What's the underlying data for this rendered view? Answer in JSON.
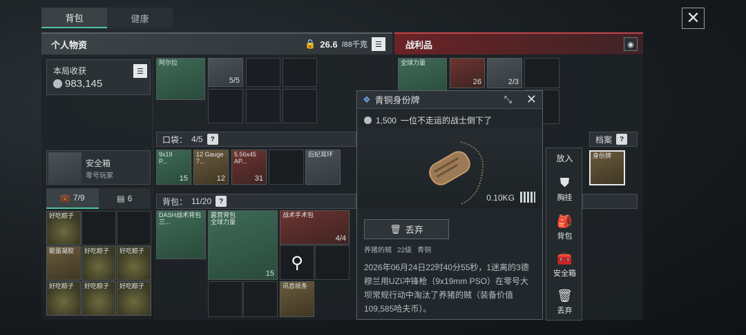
{
  "tabs": [
    "背包",
    "健康"
  ],
  "close_icon": "close-icon",
  "left_header": {
    "title": "个人物资",
    "weight": "26.6",
    "weight_max": "/88千克"
  },
  "right_header": {
    "title": "战利品"
  },
  "earnings": {
    "label": "本局收获",
    "value": "983,145"
  },
  "safebox": {
    "title": "安全箱",
    "owner": "零号玩家"
  },
  "counts": {
    "a": "7/9",
    "b": "6"
  },
  "left_items": [
    {
      "name": "好吃粽子"
    },
    {
      "name": "能量凝胶"
    },
    {
      "name": "好吃粽子"
    },
    {
      "name": "好吃粽子"
    },
    {
      "name": "好吃粽子"
    },
    {
      "name": "好吃粽子"
    },
    {
      "name": "好吃粽子"
    }
  ],
  "chest": {
    "name": "阿尔拉",
    "qty": "5/5"
  },
  "pocket": {
    "label": "口袋：",
    "count": "4/5"
  },
  "pocket_items": [
    {
      "name": "9x19\nP...",
      "qty": "15"
    },
    {
      "name": "12 Gauge\n7...",
      "qty": "12"
    },
    {
      "name": "5.56x45\nAP...",
      "qty": "31"
    },
    {
      "name": "后妃耳环",
      "qty": ""
    }
  ],
  "backpack": {
    "label": "背包：",
    "count": "11/20"
  },
  "backpack_items": [
    {
      "name": "DASH战术背包\n三...",
      "qty": ""
    },
    {
      "name": "露营背包\n全球力量",
      "qty": "15"
    },
    {
      "name": "战术手术包",
      "qty": "4/4"
    },
    {
      "name": "讯息纸条",
      "qty": ""
    }
  ],
  "loot_items": [
    {
      "name": "全球力量",
      "qty": ""
    },
    {
      "name": "",
      "qty": "26"
    },
    {
      "name": "",
      "qty": "2/3"
    }
  ],
  "dossier": {
    "label": "档案",
    "item": "身份牌"
  },
  "popup": {
    "title": "青铜身份牌",
    "value": "1,500",
    "subtitle": "一位不走运的战士倒下了",
    "weight": "0.10KG",
    "discard": "丢弃",
    "killer_name": "养猪的贼",
    "killer_level": "22级",
    "killer_rank": "青铜",
    "description": "2026年06月24日22时40分55秒，1迷离的3德穆兰用UZI冲锋枪（9x19mm PSO）在零号大坝常规行动中淘汰了养猪的贼（装备价值109,585哈夫币）。"
  },
  "side_menu": {
    "header": "放入",
    "items": [
      "胸挂",
      "背包",
      "安全箱",
      "丢弃"
    ]
  }
}
